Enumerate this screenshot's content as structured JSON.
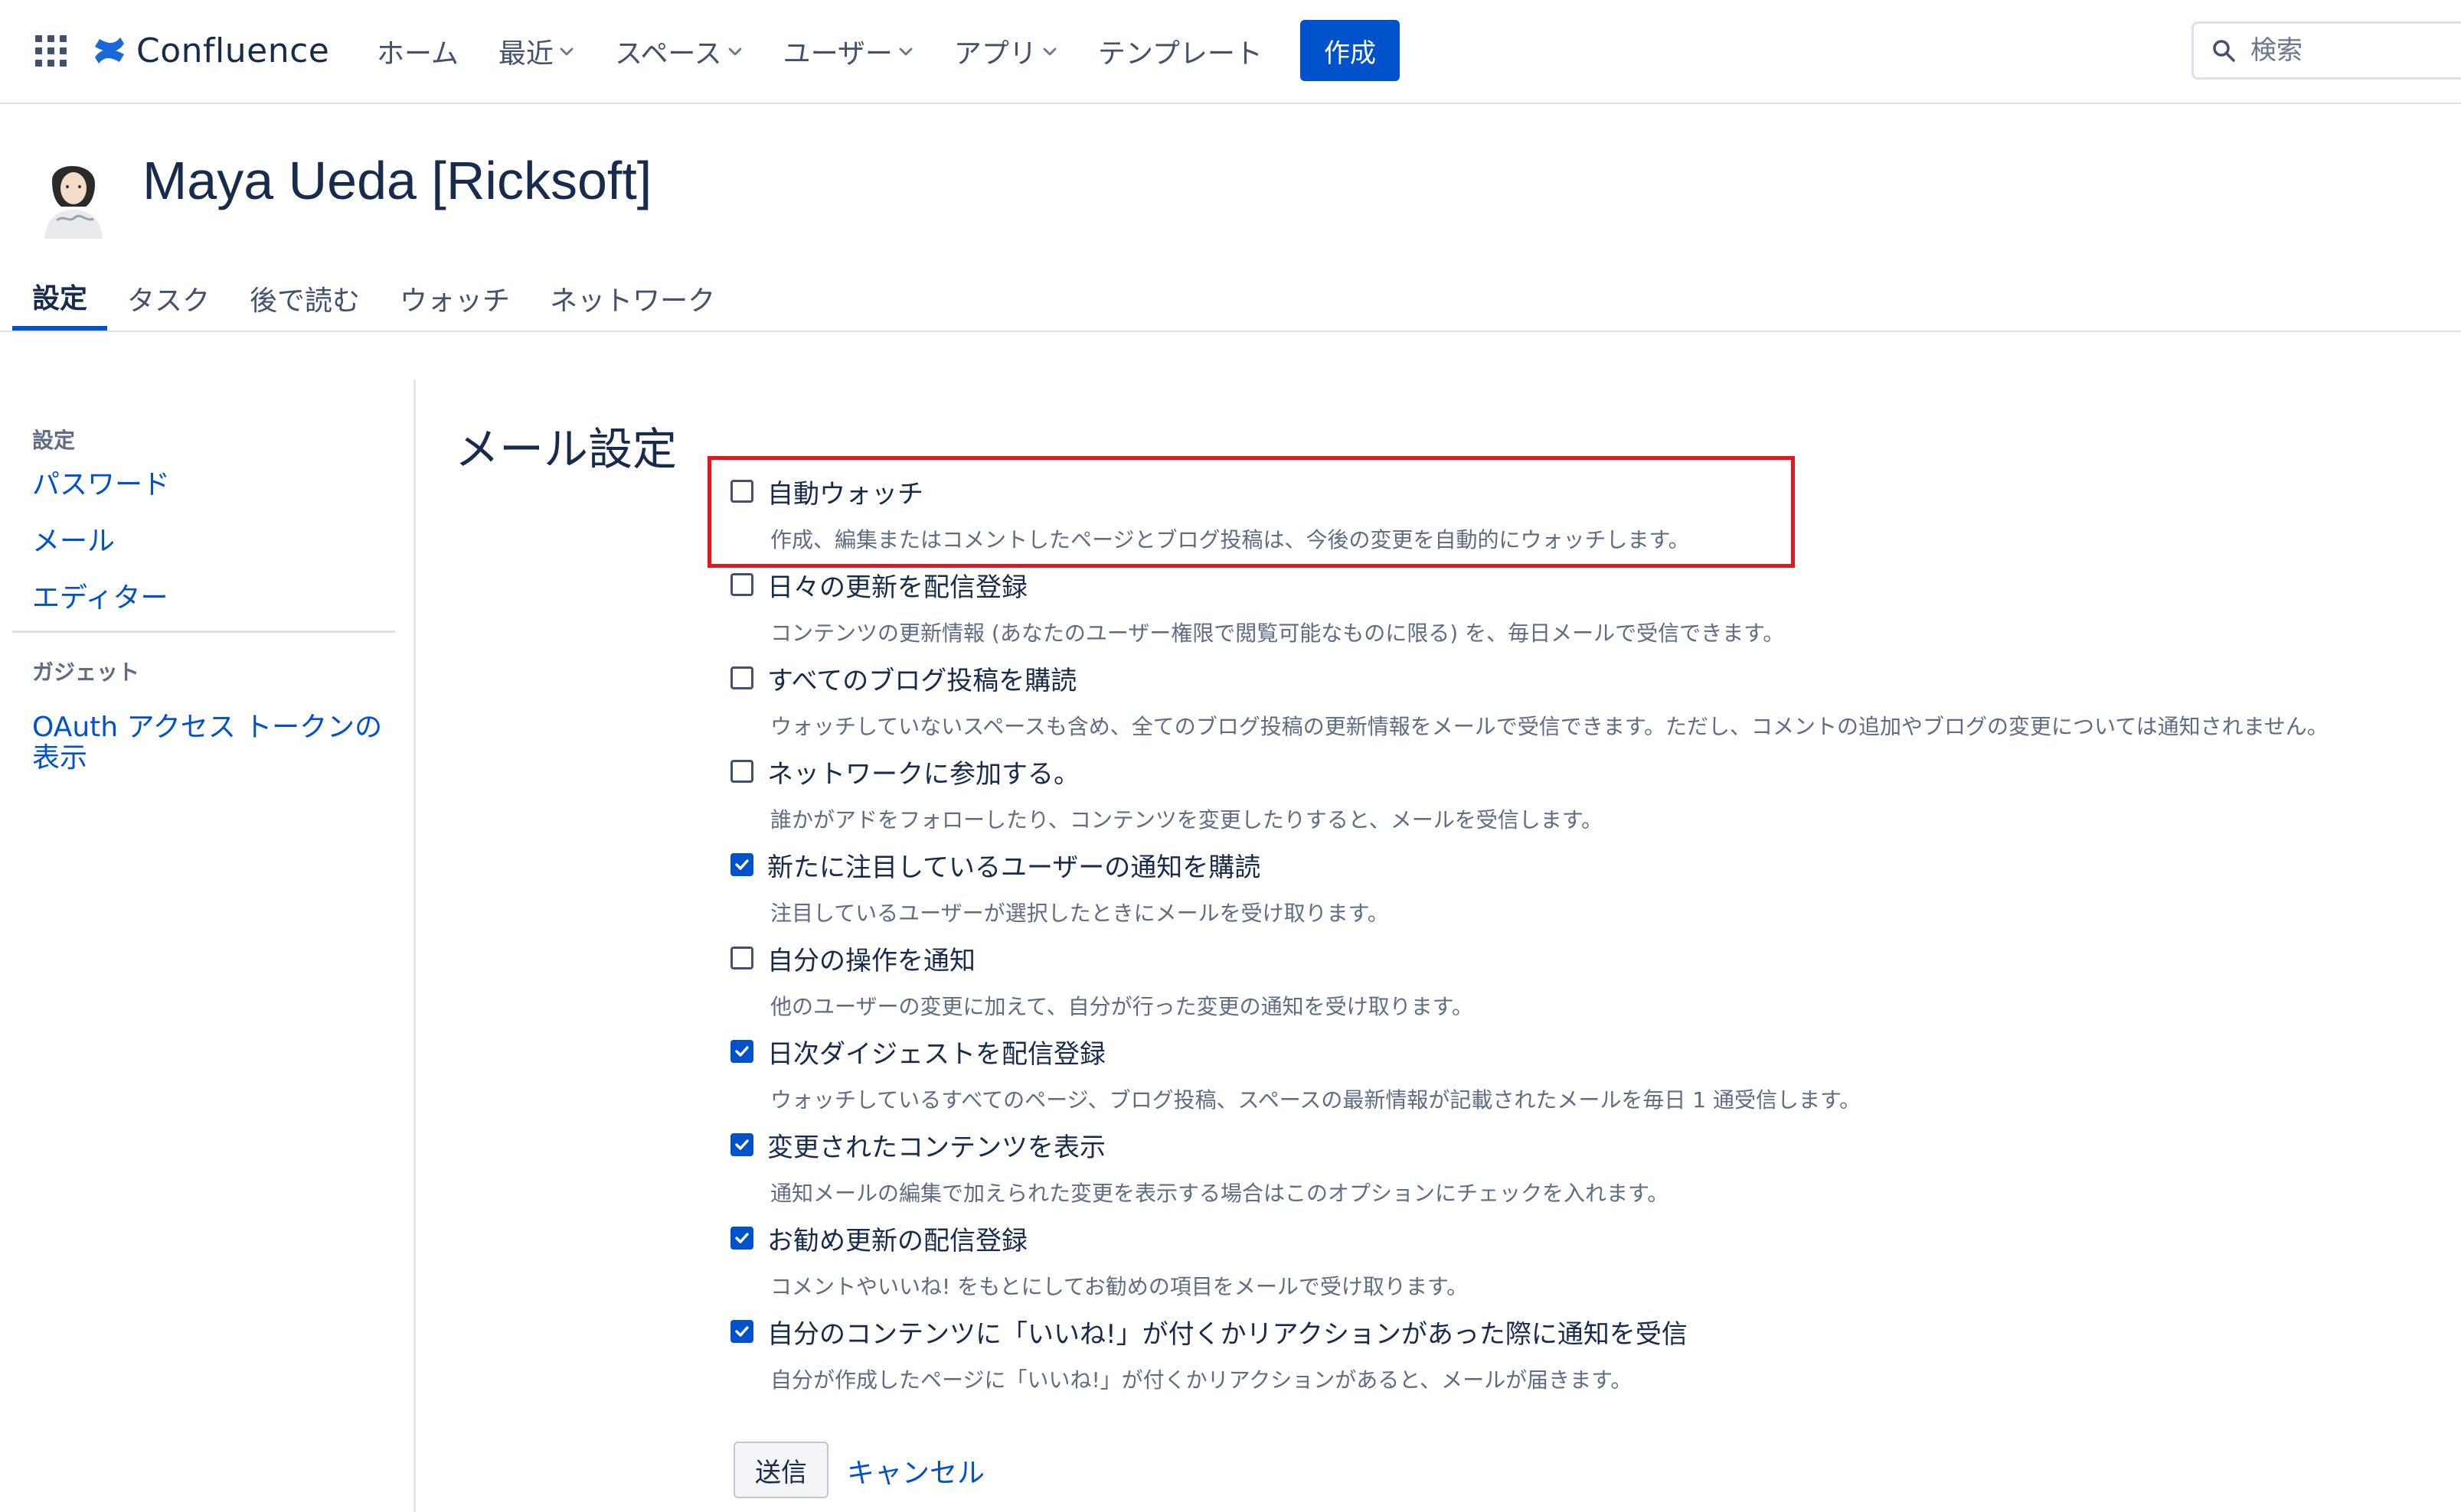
{
  "app": {
    "name": "Confluence"
  },
  "nav": {
    "items": [
      {
        "label": "ホーム",
        "dropdown": false
      },
      {
        "label": "最近",
        "dropdown": true
      },
      {
        "label": "スペース",
        "dropdown": true
      },
      {
        "label": "ユーザー",
        "dropdown": true
      },
      {
        "label": "アプリ",
        "dropdown": true
      },
      {
        "label": "テンプレート",
        "dropdown": false
      }
    ],
    "create_label": "作成",
    "search_placeholder": "検索"
  },
  "profile": {
    "name": "Maya Ueda [Ricksoft]",
    "tabs": [
      {
        "label": "設定",
        "active": true
      },
      {
        "label": "タスク",
        "active": false
      },
      {
        "label": "後で読む",
        "active": false
      },
      {
        "label": "ウォッチ",
        "active": false
      },
      {
        "label": "ネットワーク",
        "active": false
      }
    ]
  },
  "sidebar": {
    "settings_heading": "設定",
    "settings_links": [
      "パスワード",
      "メール",
      "エディター"
    ],
    "gadgets_heading": "ガジェット",
    "gadget_link": "OAuth アクセス トークンの 表示"
  },
  "main": {
    "title": "メール設定",
    "options": [
      {
        "label": "自動ウォッチ",
        "checked": false,
        "description": "作成、編集またはコメントしたページとブログ投稿は、今後の変更を自動的にウォッチします。"
      },
      {
        "label": "日々の更新を配信登録",
        "checked": false,
        "description": "コンテンツの更新情報 (あなたのユーザー権限で閲覧可能なものに限る) を、毎日メールで受信できます。"
      },
      {
        "label": "すべてのブログ投稿を購読",
        "checked": false,
        "description": "ウォッチしていないスペースも含め、全てのブログ投稿の更新情報をメールで受信できます。ただし、コメントの追加やブログの変更については通知されません。"
      },
      {
        "label": "ネットワークに参加する。",
        "checked": false,
        "description": "誰かがアドをフォローしたり、コンテンツを変更したりすると、メールを受信します。"
      },
      {
        "label": "新たに注目しているユーザーの通知を購読",
        "checked": true,
        "description": "注目しているユーザーが選択したときにメールを受け取ります。"
      },
      {
        "label": "自分の操作を通知",
        "checked": false,
        "description": "他のユーザーの変更に加えて、自分が行った変更の通知を受け取ります。"
      },
      {
        "label": "日次ダイジェストを配信登録",
        "checked": true,
        "description": "ウォッチしているすべてのページ、ブログ投稿、スペースの最新情報が記載されたメールを毎日 1 通受信します。"
      },
      {
        "label": "変更されたコンテンツを表示",
        "checked": true,
        "description": "通知メールの編集で加えられた変更を表示する場合はこのオプションにチェックを入れます。"
      },
      {
        "label": "お勧め更新の配信登録",
        "checked": true,
        "description": "コメントやいいね! をもとにしてお勧めの項目をメールで受け取ります。"
      },
      {
        "label": "自分のコンテンツに「いいね!」が付くかリアクションがあった際に通知を受信",
        "checked": true,
        "description": "自分が作成したページに「いいね!」が付くかリアクションがあると、メールが届きます。"
      }
    ],
    "submit_label": "送信",
    "cancel_label": "キャンセル"
  },
  "colors": {
    "brand": "#0052cc",
    "highlight": "#e4161e",
    "text": "#172b4d",
    "muted": "#5e6c84"
  }
}
